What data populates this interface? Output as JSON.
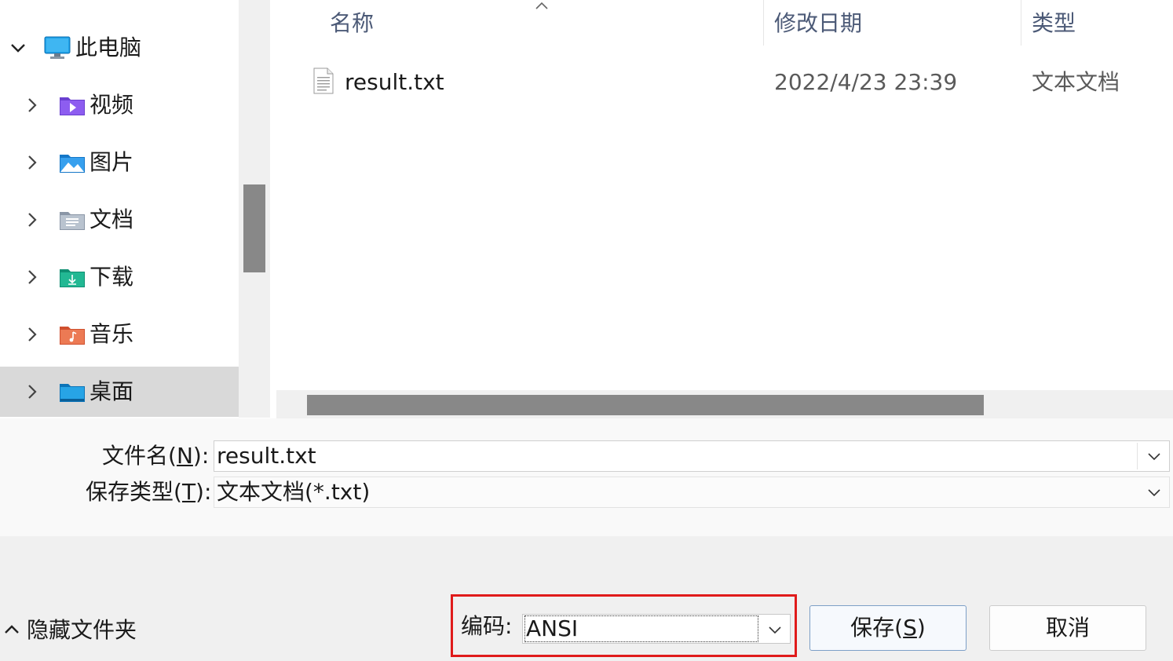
{
  "nav": {
    "items": [
      {
        "label": "此电脑",
        "expanded": true,
        "icon": "monitor-icon"
      },
      {
        "label": "视频",
        "expanded": false,
        "icon": "video-folder-icon"
      },
      {
        "label": "图片",
        "expanded": false,
        "icon": "pictures-folder-icon"
      },
      {
        "label": "文档",
        "expanded": false,
        "icon": "documents-folder-icon"
      },
      {
        "label": "下载",
        "expanded": false,
        "icon": "downloads-folder-icon"
      },
      {
        "label": "音乐",
        "expanded": false,
        "icon": "music-folder-icon"
      },
      {
        "label": "桌面",
        "expanded": false,
        "selected": true,
        "icon": "desktop-folder-icon"
      }
    ]
  },
  "file_list": {
    "columns": {
      "name": "名称",
      "modified": "修改日期",
      "type": "类型"
    },
    "rows": [
      {
        "name": "result.txt",
        "modified": "2022/4/23 23:39",
        "type": "文本文档",
        "icon": "text-file-icon"
      }
    ]
  },
  "form": {
    "filename_label": "文件名(",
    "filename_key": "N",
    "filename_label_end": "):",
    "filename_value": "result.txt",
    "filetype_label": "保存类型(",
    "filetype_key": "T",
    "filetype_label_end": "):",
    "filetype_value": "文本文档(*.txt)"
  },
  "bottom": {
    "hide_folders": "隐藏文件夹",
    "encoding_label": "编码:",
    "encoding_value": "ANSI",
    "save_label": "保存(",
    "save_key": "S",
    "save_label_end": ")",
    "cancel_label": "取消"
  },
  "colors": {
    "highlight_border": "#e01b1b",
    "selected_nav": "#d9d9d9",
    "header_text": "#4c5a77"
  }
}
